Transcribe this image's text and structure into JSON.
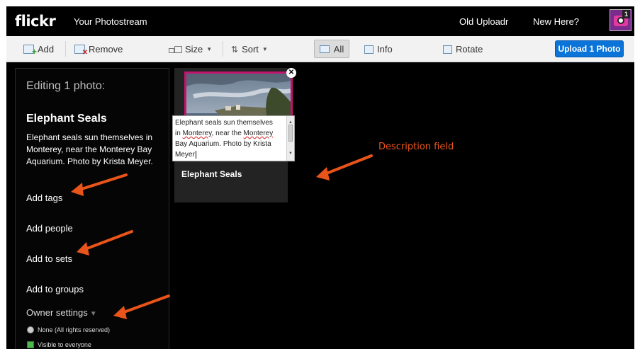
{
  "topbar": {
    "logo": "flickr",
    "photostream": "Your Photostream",
    "old_uploadr": "Old Uploadr",
    "new_here": "New Here?",
    "notification_count": "1"
  },
  "toolbar": {
    "add": "Add",
    "remove": "Remove",
    "size": "Size",
    "sort": "Sort",
    "all": "All",
    "info": "Info",
    "rotate": "Rotate",
    "upload": "Upload 1 Photo"
  },
  "sidebar": {
    "heading": "Editing 1 photo:",
    "title": "Elephant Seals",
    "description": "Elephant seals sun themselves in Monterey, near the Monterey Bay Aquarium. Photo by Krista Meyer.",
    "add_tags": "Add tags",
    "add_people": "Add people",
    "add_to_sets": "Add to sets",
    "add_to_groups": "Add to groups",
    "owner_settings": "Owner settings",
    "license_option": "None (All rights reserved)",
    "visibility_option": "Visible to everyone"
  },
  "photo_card": {
    "title": "Elephant Seals",
    "description_lines": [
      "Elephant seals sun themselves",
      "in ",
      "Monterey",
      ", near the ",
      "Monterey",
      "Bay Aquarium. Photo by Krista",
      "Meyer"
    ]
  },
  "annotation": {
    "label": "Description field",
    "color": "#e8541a"
  },
  "colors": {
    "upload_button": "#0a74d9",
    "thumb_border": "#c0146f",
    "background": "#000000"
  }
}
